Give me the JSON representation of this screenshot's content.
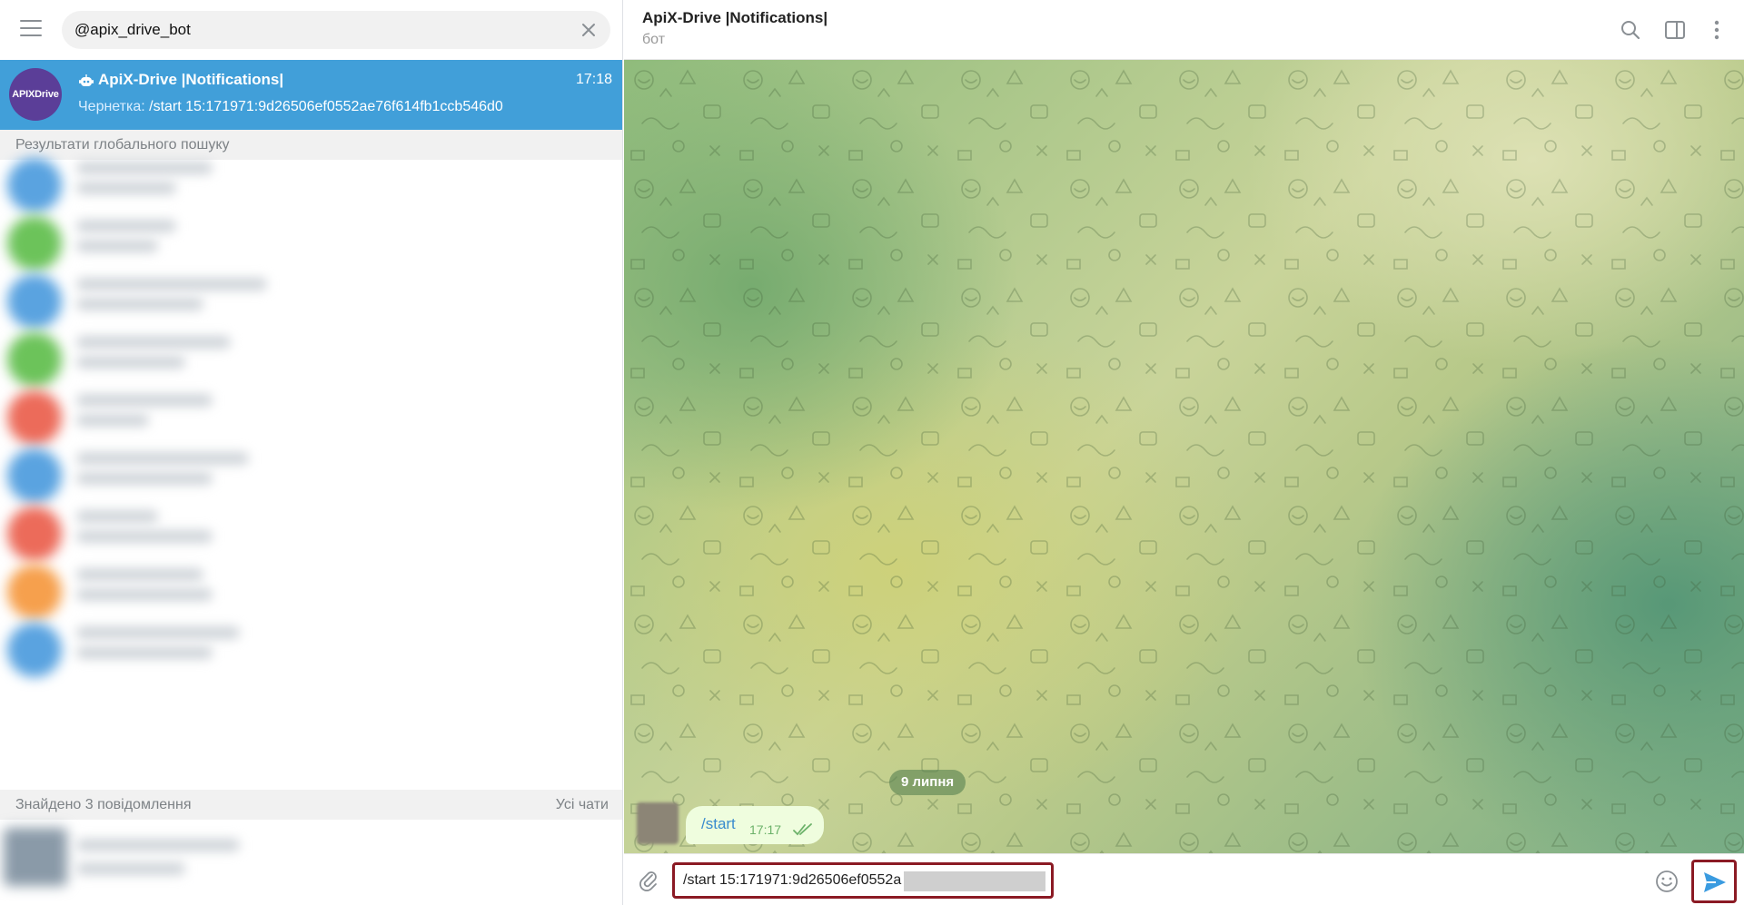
{
  "search": {
    "value": "@apix_drive_bot"
  },
  "active_chat": {
    "avatar_text": "APIXDrive",
    "title": "ApiX-Drive |Notifications|",
    "time": "17:18",
    "draft_label": "Чернетка:",
    "draft_text": "/start 15:171971:9d26506ef0552ae76f614fb1ccb546d0"
  },
  "global_results_header": "Результати глобального пошуку",
  "found_header": {
    "label": "Знайдено 3 повідомлення",
    "all_chats": "Усі чати"
  },
  "blurred_avatar_colors": [
    "#5aa3e0",
    "#6cc35a",
    "#5aa3e0",
    "#6cc35a",
    "#ec6b5a",
    "#5aa3e0",
    "#ec6b5a",
    "#f6a04d",
    "#5aa3e0"
  ],
  "header": {
    "title": "ApiX-Drive |Notifications|",
    "status": "бот"
  },
  "icons": {
    "menu": "hamburger-icon",
    "clear": "close-icon",
    "search": "search-icon",
    "sidebar": "sidebar-icon",
    "more": "more-vertical-icon",
    "attach": "paperclip-icon",
    "emoji": "emoji-icon",
    "send": "send-icon",
    "bot": "bot-icon"
  },
  "chat": {
    "date": "9 липня",
    "message": {
      "text": "/start",
      "time": "17:17"
    }
  },
  "composer": {
    "text": "/start 15:171971:9d26506ef0552a"
  },
  "colors": {
    "accent": "#419fd9",
    "highlight_border": "#8b1a24",
    "bubble": "#effdde"
  }
}
